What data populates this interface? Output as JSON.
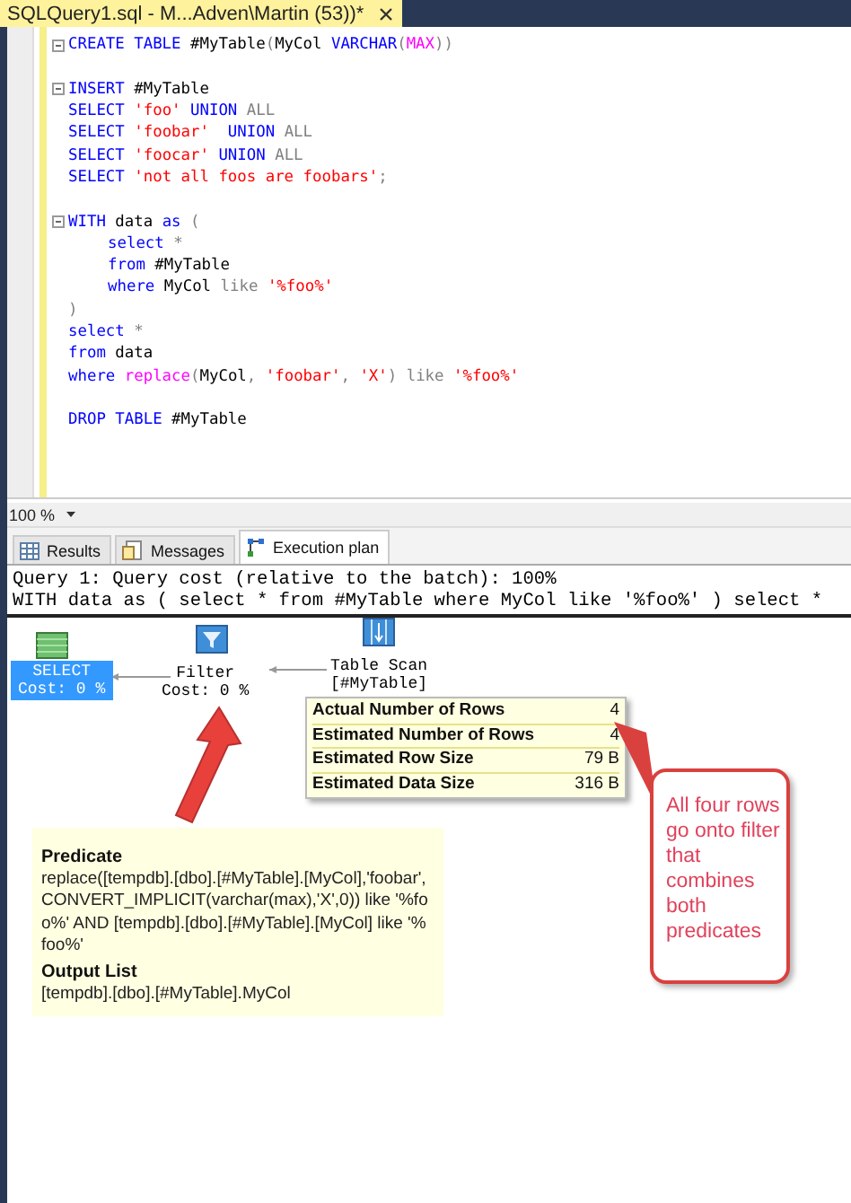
{
  "editor_tab": {
    "title": "SQLQuery1.sql - M...Adven\\Martin (53))*"
  },
  "code_lines": [
    {
      "kind": "code",
      "collapsible": true,
      "indented": false,
      "tokens": [
        {
          "kind": "kw",
          "text": "CREATE TABLE "
        },
        {
          "kind": "id",
          "text": "#MyTable"
        },
        {
          "kind": "op",
          "text": "("
        },
        {
          "kind": "id",
          "text": "MyCol "
        },
        {
          "kind": "kw",
          "text": "VARCHAR"
        },
        {
          "kind": "op",
          "text": "("
        },
        {
          "kind": "fn",
          "text": "MAX"
        },
        {
          "kind": "op",
          "text": "))"
        }
      ]
    },
    {
      "kind": "blank"
    },
    {
      "kind": "code",
      "collapsible": true,
      "indented": false,
      "tokens": [
        {
          "kind": "kw",
          "text": "INSERT "
        },
        {
          "kind": "id",
          "text": "#MyTable"
        }
      ]
    },
    {
      "kind": "code",
      "collapsible": false,
      "indented": false,
      "tokens": [
        {
          "kind": "kw",
          "text": "SELECT "
        },
        {
          "kind": "str",
          "text": "'foo'"
        },
        {
          "kind": "kw",
          "text": " UNION "
        },
        {
          "kind": "op",
          "text": "ALL"
        }
      ]
    },
    {
      "kind": "code",
      "collapsible": false,
      "indented": false,
      "tokens": [
        {
          "kind": "kw",
          "text": "SELECT "
        },
        {
          "kind": "str",
          "text": "'foobar'"
        },
        {
          "kind": "kw",
          "text": "  UNION "
        },
        {
          "kind": "op",
          "text": "ALL"
        }
      ]
    },
    {
      "kind": "code",
      "collapsible": false,
      "indented": false,
      "tokens": [
        {
          "kind": "kw",
          "text": "SELECT "
        },
        {
          "kind": "str",
          "text": "'foocar'"
        },
        {
          "kind": "kw",
          "text": " UNION "
        },
        {
          "kind": "op",
          "text": "ALL"
        }
      ]
    },
    {
      "kind": "code",
      "collapsible": false,
      "indented": false,
      "tokens": [
        {
          "kind": "kw",
          "text": "SELECT "
        },
        {
          "kind": "str",
          "text": "'not all foos are foobars'"
        },
        {
          "kind": "op",
          "text": ";"
        }
      ]
    },
    {
      "kind": "blank"
    },
    {
      "kind": "code",
      "collapsible": true,
      "indented": false,
      "tokens": [
        {
          "kind": "kw",
          "text": "WITH "
        },
        {
          "kind": "id",
          "text": "data "
        },
        {
          "kind": "kw",
          "text": "as "
        },
        {
          "kind": "op",
          "text": "("
        }
      ]
    },
    {
      "kind": "code",
      "collapsible": false,
      "indented": true,
      "tokens": [
        {
          "kind": "kw",
          "text": "select "
        },
        {
          "kind": "op",
          "text": "*"
        }
      ]
    },
    {
      "kind": "code",
      "collapsible": false,
      "indented": true,
      "tokens": [
        {
          "kind": "kw",
          "text": "from "
        },
        {
          "kind": "id",
          "text": "#MyTable"
        }
      ]
    },
    {
      "kind": "code",
      "collapsible": false,
      "indented": true,
      "tokens": [
        {
          "kind": "kw",
          "text": "where "
        },
        {
          "kind": "id",
          "text": "MyCol "
        },
        {
          "kind": "op",
          "text": "like "
        },
        {
          "kind": "str",
          "text": "'%foo%'"
        }
      ]
    },
    {
      "kind": "code",
      "collapsible": false,
      "indented": false,
      "tokens": [
        {
          "kind": "op",
          "text": ")"
        }
      ]
    },
    {
      "kind": "code",
      "collapsible": false,
      "indented": false,
      "tokens": [
        {
          "kind": "kw",
          "text": "select "
        },
        {
          "kind": "op",
          "text": "*"
        }
      ]
    },
    {
      "kind": "code",
      "collapsible": false,
      "indented": false,
      "tokens": [
        {
          "kind": "kw",
          "text": "from "
        },
        {
          "kind": "id",
          "text": "data"
        }
      ]
    },
    {
      "kind": "code",
      "collapsible": false,
      "indented": false,
      "tokens": [
        {
          "kind": "kw",
          "text": "where "
        },
        {
          "kind": "fn",
          "text": "replace"
        },
        {
          "kind": "op",
          "text": "("
        },
        {
          "kind": "id",
          "text": "MyCol"
        },
        {
          "kind": "op",
          "text": ", "
        },
        {
          "kind": "str",
          "text": "'foobar'"
        },
        {
          "kind": "op",
          "text": ", "
        },
        {
          "kind": "str",
          "text": "'X'"
        },
        {
          "kind": "op",
          "text": ") like "
        },
        {
          "kind": "str",
          "text": "'%foo%'"
        }
      ]
    },
    {
      "kind": "blank"
    },
    {
      "kind": "code",
      "collapsible": false,
      "indented": false,
      "tokens": [
        {
          "kind": "kw",
          "text": "DROP TABLE "
        },
        {
          "kind": "id",
          "text": "#MyTable"
        }
      ]
    }
  ],
  "zoom": "100 %",
  "result_tabs": [
    {
      "kind": "grid",
      "label": "Results",
      "selected": false
    },
    {
      "kind": "messages",
      "label": "Messages",
      "selected": false
    },
    {
      "kind": "plan",
      "label": "Execution plan",
      "selected": true
    }
  ],
  "plan_header": [
    "Query 1: Query cost (relative to the batch): 100%",
    "WITH data as ( select * from #MyTable where MyCol like '%foo%' ) select *"
  ],
  "plan_nodes": [
    {
      "kind": "select",
      "label": "SELECT",
      "cost": "Cost: 0 %",
      "selected": true
    },
    {
      "kind": "filter",
      "label": "Filter",
      "cost": "Cost: 0 %",
      "selected": false
    },
    {
      "kind": "scan",
      "label": "Table Scan",
      "cost": "[#MyTable]",
      "selected": false
    }
  ],
  "row_tooltip": [
    {
      "name": "Actual Number of Rows",
      "value": "4"
    },
    {
      "name": "Estimated Number of Rows",
      "value": "4"
    },
    {
      "name": "Estimated Row Size",
      "value": "79 B"
    },
    {
      "name": "Estimated Data Size",
      "value": "316 B"
    }
  ],
  "filter_tooltip": [
    {
      "heading": "Predicate",
      "text": "replace([tempdb].[dbo].[#MyTable].[MyCol],'foobar',CONVERT_IMPLICIT(varchar(max),'X',0)) like '%foo%' AND [tempdb].[dbo].[#MyTable].[MyCol] like '%foo%'"
    },
    {
      "heading": "Output List",
      "text": "[tempdb].[dbo].[#MyTable].MyCol"
    }
  ],
  "callout": "All four rows go onto filter that combines both predicates"
}
